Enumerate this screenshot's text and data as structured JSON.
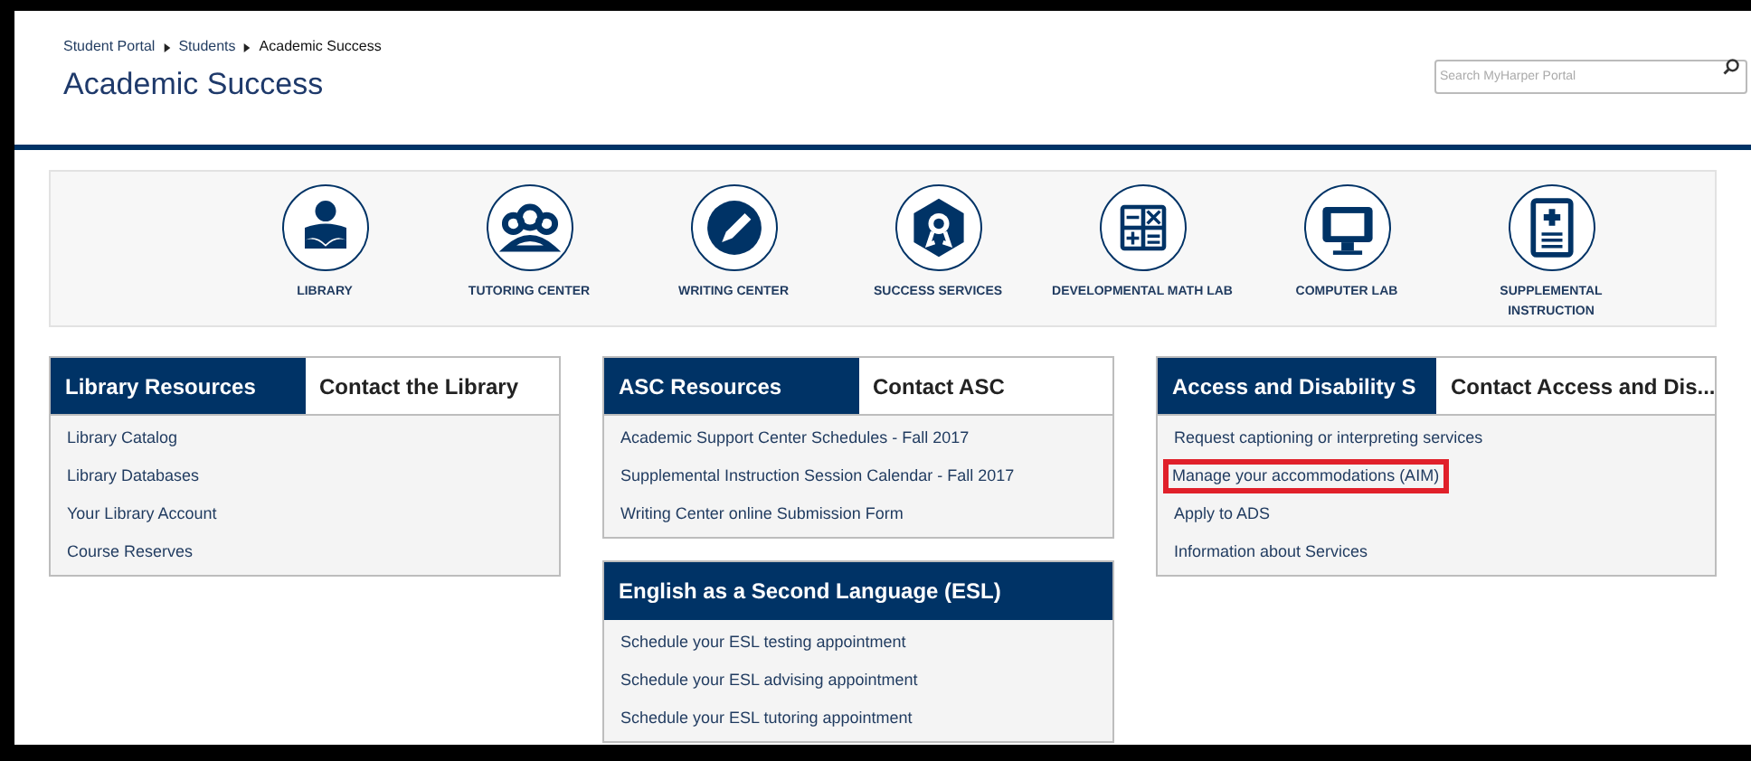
{
  "breadcrumb": [
    {
      "label": "Student Portal",
      "link": true
    },
    {
      "label": "Students",
      "link": true
    },
    {
      "label": "Academic Success",
      "link": false
    }
  ],
  "page_title": "Academic Success",
  "search": {
    "placeholder": "Search MyHarper Portal"
  },
  "services": [
    {
      "kind": "person",
      "label": "LIBRARY"
    },
    {
      "kind": "group",
      "label": "TUTORING CENTER"
    },
    {
      "kind": "pencil",
      "label": "WRITING CENTER"
    },
    {
      "kind": "award",
      "label": "SUCCESS SERVICES"
    },
    {
      "kind": "calculator",
      "label": "DEVELOPMENTAL MATH LAB"
    },
    {
      "kind": "monitor",
      "label": "COMPUTER LAB"
    },
    {
      "kind": "document",
      "label": "SUPPLEMENTAL INSTRUCTION"
    }
  ],
  "columns": [
    [
      {
        "tabs": [
          {
            "label": "Library Resources",
            "selected": true
          },
          {
            "label": "Contact the Library",
            "selected": false
          }
        ],
        "links": [
          {
            "label": "Library Catalog",
            "highlighted": false
          },
          {
            "label": "Library Databases",
            "highlighted": false
          },
          {
            "label": "Your Library Account",
            "highlighted": false
          },
          {
            "label": "Course Reserves",
            "highlighted": false
          }
        ]
      }
    ],
    [
      {
        "tabs": [
          {
            "label": "ASC Resources",
            "selected": true
          },
          {
            "label": "Contact ASC",
            "selected": false
          }
        ],
        "links": [
          {
            "label": "Academic Support Center Schedules - Fall 2017",
            "highlighted": false
          },
          {
            "label": "Supplemental Instruction Session Calendar - Fall 2017",
            "highlighted": false
          },
          {
            "label": "Writing Center online Submission Form",
            "highlighted": false
          }
        ]
      },
      {
        "title": "English as a Second Language (ESL)",
        "links": [
          {
            "label": "Schedule your ESL testing appointment",
            "highlighted": false
          },
          {
            "label": "Schedule your ESL advising appointment",
            "highlighted": false
          },
          {
            "label": "Schedule your ESL tutoring appointment",
            "highlighted": false
          }
        ]
      }
    ],
    [
      {
        "tabs": [
          {
            "label": "Access and Disability S",
            "selected": true
          },
          {
            "label": "Contact Access and Dis...",
            "selected": false
          }
        ],
        "links": [
          {
            "label": "Request captioning or interpreting services",
            "highlighted": false
          },
          {
            "label": "Manage your accommodations (AIM)",
            "highlighted": true
          },
          {
            "label": "Apply to ADS",
            "highlighted": false
          },
          {
            "label": "Information about Services",
            "highlighted": false
          }
        ]
      }
    ]
  ]
}
